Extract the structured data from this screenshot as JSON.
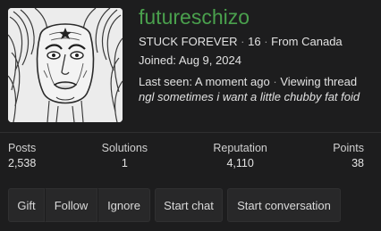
{
  "profile": {
    "username": "futureschizo",
    "title": "STUCK FOREVER",
    "age": "16",
    "location": "From Canada",
    "joined": "Joined: Aug 9, 2024",
    "last_seen": "Last seen: A moment ago",
    "activity": "Viewing thread",
    "signature": "ngl sometimes i want a little chubby fat foid",
    "separator": "·",
    "avatar_icon": "manga-face-avatar",
    "username_color": "#4aa04d"
  },
  "stats": [
    {
      "label": "Posts",
      "value": "2,538"
    },
    {
      "label": "Solutions",
      "value": "1"
    },
    {
      "label": "Reputation",
      "value": "4,110"
    },
    {
      "label": "Points",
      "value": "38"
    }
  ],
  "actions": {
    "gift": "Gift",
    "follow": "Follow",
    "ignore": "Ignore",
    "start_chat": "Start chat",
    "start_conversation": "Start conversation"
  }
}
